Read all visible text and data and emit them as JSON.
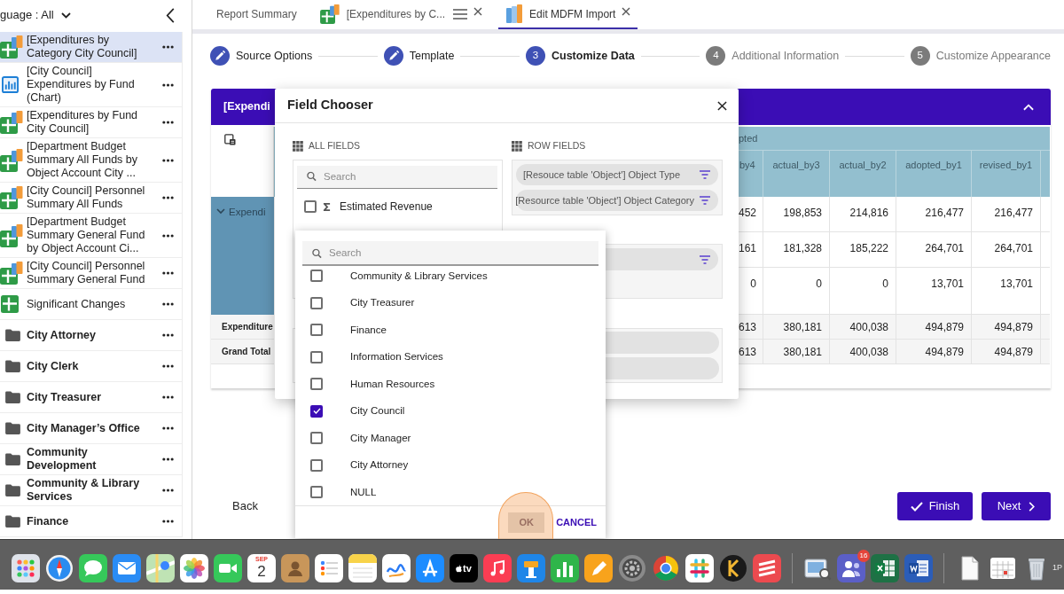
{
  "sidebar": {
    "filter_label": "guage : All",
    "items": [
      {
        "kind": "report",
        "label": "[Expenditures by Category City Council]",
        "selected": true
      },
      {
        "kind": "chart",
        "label": "[City Council] Expenditures by Fund (Chart)",
        "selected": false
      },
      {
        "kind": "report",
        "label": "[Expenditures by Fund City Council]",
        "selected": false
      },
      {
        "kind": "report",
        "label": "[Department Budget Summary All Funds by Object Account City ...",
        "selected": false
      },
      {
        "kind": "report",
        "label": "[City Council] Personnel Summary All Funds",
        "selected": false
      },
      {
        "kind": "report",
        "label": "[Department Budget Summary General Fund by Object Account Ci...",
        "selected": false
      },
      {
        "kind": "report",
        "label": "[City Council] Personnel Summary General Fund",
        "selected": false
      },
      {
        "kind": "sheet",
        "label": "Significant Changes",
        "selected": false
      },
      {
        "kind": "folder",
        "label": "City Attorney",
        "selected": false
      },
      {
        "kind": "folder",
        "label": "City Clerk",
        "selected": false
      },
      {
        "kind": "folder",
        "label": "City Treasurer",
        "selected": false
      },
      {
        "kind": "folder",
        "label": "City Manager’s Office",
        "selected": false
      },
      {
        "kind": "folder",
        "label": "Community Development",
        "selected": false
      },
      {
        "kind": "folder",
        "label": "Community & Library Services",
        "selected": false
      },
      {
        "kind": "folder",
        "label": "Finance",
        "selected": false
      }
    ]
  },
  "tabs": [
    {
      "kind": "plain",
      "label": "Report Summary",
      "selected": false,
      "has_menu": false,
      "closable": false
    },
    {
      "kind": "report",
      "label": "[Expenditures by C...",
      "selected": false,
      "has_menu": true,
      "closable": true
    },
    {
      "kind": "import",
      "label": "Edit MDFM Import",
      "selected": true,
      "has_menu": false,
      "closable": true
    }
  ],
  "steps": [
    {
      "label": "Source Options",
      "completed": true,
      "selected": false
    },
    {
      "label": "Template",
      "completed": true,
      "selected": false
    },
    {
      "number": "3",
      "label": "Customize Data",
      "completed": false,
      "selected": true
    },
    {
      "number": "4",
      "label": "Additional Information",
      "completed": false,
      "selected": false
    },
    {
      "number": "5",
      "label": "Customize Appearance",
      "completed": false,
      "selected": false
    }
  ],
  "report_panel": {
    "title": "[Expendi",
    "expanded": true,
    "table": {
      "group_header": "pted",
      "columns": [
        "by4",
        "actual_by3",
        "actual_by2",
        "adopted_by1",
        "revised_by1"
      ],
      "row_group": {
        "label": "Expendi",
        "expanded": true
      },
      "rows": [
        [
          "452",
          "198,853",
          "214,816",
          "216,477",
          "216,477"
        ],
        [
          "161",
          "181,328",
          "185,222",
          "264,701",
          "264,701"
        ],
        [
          "0",
          "0",
          "0",
          "13,701",
          "13,701"
        ]
      ],
      "totals": [
        {
          "label": "Expenditure",
          "values": [
            "613",
            "380,181",
            "400,038",
            "494,879",
            "494,879"
          ]
        },
        {
          "label": "Grand Total",
          "values": [
            "613",
            "380,181",
            "400,038",
            "494,879",
            "494,879"
          ]
        }
      ]
    }
  },
  "actions": {
    "back": "Back",
    "finish": "Finish",
    "next": "Next"
  },
  "field_chooser": {
    "title": "Field Chooser",
    "all_fields": {
      "heading": "ALL FIELDS",
      "search_placeholder": "Search",
      "items": [
        {
          "kind": "measure",
          "label": "Estimated Revenue",
          "checked": false
        }
      ]
    },
    "row_fields": {
      "heading": "ROW FIELDS",
      "pills": [
        {
          "label": "[Resouce table 'Object'] Object Type",
          "filterable": true
        },
        {
          "label": "[Resource table 'Object'] Object Category",
          "filterable": true
        }
      ]
    },
    "column_fields": {
      "pills": [
        {
          "filterable": true
        }
      ]
    },
    "data_fields": {
      "pills": [
        {
          "filterable": false
        },
        {
          "filterable": false
        }
      ]
    }
  },
  "value_filter": {
    "search_placeholder": "Search",
    "options": [
      {
        "label": "Community & Library Services",
        "checked": false
      },
      {
        "label": "City Treasurer",
        "checked": false
      },
      {
        "label": "Finance",
        "checked": false
      },
      {
        "label": "Information Services",
        "checked": false
      },
      {
        "label": "Human Resources",
        "checked": false
      },
      {
        "label": "City Council",
        "checked": true
      },
      {
        "label": "City Manager",
        "checked": false
      },
      {
        "label": "City Attorney",
        "checked": false
      },
      {
        "label": "NULL",
        "checked": false
      }
    ],
    "ok": "OK",
    "cancel": "CANCEL"
  },
  "dock": {
    "calendar_month": "SEP",
    "calendar_day": "2",
    "tv_label": "tv",
    "chat_badge": "16",
    "edge_text": "1P"
  }
}
